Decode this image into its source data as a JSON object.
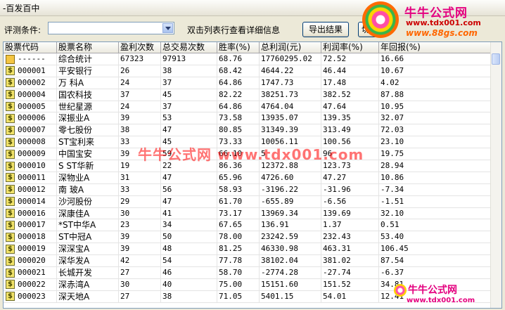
{
  "window": {
    "title": "-百发百中"
  },
  "toolbar": {
    "filter_label": "评测条件:",
    "filter_value": "",
    "hint": "双击列表行查看详细信息",
    "export_label": "导出结果",
    "second_button_label": "切"
  },
  "logo": {
    "title": "牛牛公式网",
    "url1": "www.tdx001.com",
    "url2": "www.88gs.com"
  },
  "watermarks": {
    "center": "牛牛公式网 www.tdx001.com",
    "corner_title": "牛牛公式网",
    "corner_url": "www.tdx001.com"
  },
  "table": {
    "columns": [
      "股票代码",
      "股票名称",
      "盈利次数",
      "总交易次数",
      "胜率(%)",
      "总利润(元)",
      "利润率(%)",
      "年回报(%)"
    ],
    "rows": [
      {
        "code": "------",
        "name": "综合统计",
        "wins": "67323",
        "trades": "97913",
        "rate": "68.76",
        "profit": "17760295.02",
        "margin": "72.52",
        "annual": "16.66",
        "icon": "folder"
      },
      {
        "code": "000001",
        "name": "平安银行",
        "wins": "26",
        "trades": "38",
        "rate": "68.42",
        "profit": "4644.22",
        "margin": "46.44",
        "annual": "10.67",
        "icon": "stock"
      },
      {
        "code": "000002",
        "name": "万  科A",
        "wins": "24",
        "trades": "37",
        "rate": "64.86",
        "profit": "1747.73",
        "margin": "17.48",
        "annual": "4.02",
        "icon": "stock"
      },
      {
        "code": "000004",
        "name": "国农科技",
        "wins": "37",
        "trades": "45",
        "rate": "82.22",
        "profit": "38251.73",
        "margin": "382.52",
        "annual": "87.88",
        "icon": "stock"
      },
      {
        "code": "000005",
        "name": "世纪星源",
        "wins": "24",
        "trades": "37",
        "rate": "64.86",
        "profit": "4764.04",
        "margin": "47.64",
        "annual": "10.95",
        "icon": "stock"
      },
      {
        "code": "000006",
        "name": "深振业A",
        "wins": "39",
        "trades": "53",
        "rate": "73.58",
        "profit": "13935.07",
        "margin": "139.35",
        "annual": "32.07",
        "icon": "stock"
      },
      {
        "code": "000007",
        "name": "零七股份",
        "wins": "38",
        "trades": "47",
        "rate": "80.85",
        "profit": "31349.39",
        "margin": "313.49",
        "annual": "72.03",
        "icon": "stock"
      },
      {
        "code": "000008",
        "name": "ST宝利来",
        "wins": "33",
        "trades": "45",
        "rate": "73.33",
        "profit": "10056.11",
        "margin": "100.56",
        "annual": "23.10",
        "icon": "stock"
      },
      {
        "code": "000009",
        "name": "中国宝安",
        "wins": "39",
        "trades": "59",
        "rate": "66.10",
        "profit": "5",
        "margin": "96",
        "annual": "19.75",
        "icon": "stock"
      },
      {
        "code": "000010",
        "name": "S ST华新",
        "wins": "19",
        "trades": "22",
        "rate": "86.36",
        "profit": "12372.88",
        "margin": "123.73",
        "annual": "28.94",
        "icon": "stock"
      },
      {
        "code": "000011",
        "name": "深物业A",
        "wins": "31",
        "trades": "47",
        "rate": "65.96",
        "profit": "4726.60",
        "margin": "47.27",
        "annual": "10.86",
        "icon": "stock"
      },
      {
        "code": "000012",
        "name": "南  玻A",
        "wins": "33",
        "trades": "56",
        "rate": "58.93",
        "profit": "-3196.22",
        "margin": "-31.96",
        "annual": "-7.34",
        "icon": "stock"
      },
      {
        "code": "000014",
        "name": "沙河股份",
        "wins": "29",
        "trades": "47",
        "rate": "61.70",
        "profit": "-655.89",
        "margin": "-6.56",
        "annual": "-1.51",
        "icon": "stock"
      },
      {
        "code": "000016",
        "name": "深康佳A",
        "wins": "30",
        "trades": "41",
        "rate": "73.17",
        "profit": "13969.34",
        "margin": "139.69",
        "annual": "32.10",
        "icon": "stock"
      },
      {
        "code": "000017",
        "name": "*ST中华A",
        "wins": "23",
        "trades": "34",
        "rate": "67.65",
        "profit": "136.91",
        "margin": "1.37",
        "annual": "0.51",
        "icon": "stock"
      },
      {
        "code": "000018",
        "name": "ST中冠A",
        "wins": "39",
        "trades": "50",
        "rate": "78.00",
        "profit": "23242.59",
        "margin": "232.43",
        "annual": "53.40",
        "icon": "stock"
      },
      {
        "code": "000019",
        "name": "深深宝A",
        "wins": "39",
        "trades": "48",
        "rate": "81.25",
        "profit": "46330.98",
        "margin": "463.31",
        "annual": "106.45",
        "icon": "stock"
      },
      {
        "code": "000020",
        "name": "深华发A",
        "wins": "42",
        "trades": "54",
        "rate": "77.78",
        "profit": "38102.04",
        "margin": "381.02",
        "annual": "87.54",
        "icon": "stock"
      },
      {
        "code": "000021",
        "name": "长城开发",
        "wins": "27",
        "trades": "46",
        "rate": "58.70",
        "profit": "-2774.28",
        "margin": "-27.74",
        "annual": "-6.37",
        "icon": "stock"
      },
      {
        "code": "000022",
        "name": "深赤湾A",
        "wins": "30",
        "trades": "40",
        "rate": "75.00",
        "profit": "15151.60",
        "margin": "151.52",
        "annual": "34.81",
        "icon": "stock"
      },
      {
        "code": "000023",
        "name": "深天地A",
        "wins": "27",
        "trades": "38",
        "rate": "71.05",
        "profit": "5401.15",
        "margin": "54.01",
        "annual": "12.41",
        "icon": "stock"
      }
    ]
  }
}
